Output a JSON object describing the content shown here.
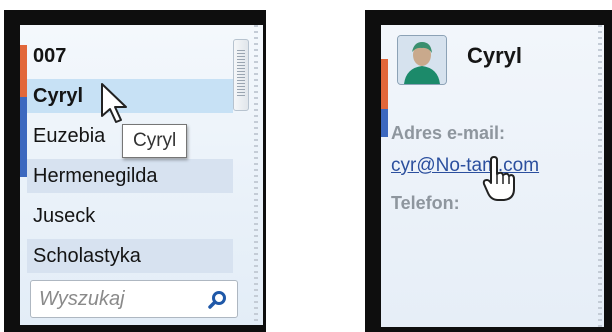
{
  "left_panel": {
    "contacts": [
      {
        "name": "007",
        "bold": true
      },
      {
        "name": "Cyryl",
        "bold": true,
        "selected": true
      },
      {
        "name": "Euzebia",
        "bold": false
      },
      {
        "name": "Hermenegilda",
        "bold": false,
        "striped": true
      },
      {
        "name": "Juseck",
        "bold": false
      },
      {
        "name": "Scholastyka",
        "bold": false,
        "striped": true
      }
    ],
    "tooltip": "Cyryl",
    "search": {
      "placeholder": "Wyszukaj"
    }
  },
  "right_panel": {
    "contact_name": "Cyryl",
    "email_label": "Adres e-mail:",
    "email_value": "cyr@No-tam.com",
    "phone_label": "Telefon:"
  },
  "colors": {
    "accent_orange": "#e2673a",
    "accent_blue": "#3c68bf",
    "selection": "#c7e1f5",
    "link": "#2b4f9e"
  },
  "icons": [
    "search-icon",
    "avatar-person-icon",
    "arrow-cursor-icon",
    "hand-cursor-icon"
  ]
}
